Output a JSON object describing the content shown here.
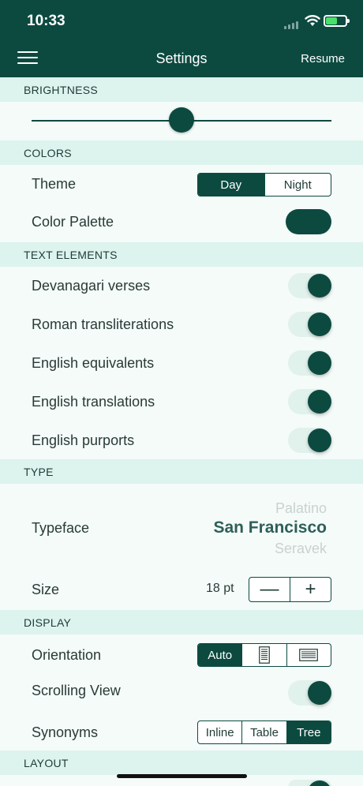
{
  "status_bar": {
    "time": "10:33"
  },
  "nav": {
    "title": "Settings",
    "resume_label": "Resume"
  },
  "brightness": {
    "header": "BRIGHTNESS",
    "level": 0.5
  },
  "colors": {
    "header": "COLORS",
    "theme_label": "Theme",
    "theme_options": [
      "Day",
      "Night"
    ],
    "theme_selected": "Day",
    "palette_label": "Color Palette"
  },
  "text_elements": {
    "header": "TEXT ELEMENTS",
    "items": [
      {
        "label": "Devanagari verses",
        "on": true
      },
      {
        "label": "Roman transliterations",
        "on": true
      },
      {
        "label": "English equivalents",
        "on": true
      },
      {
        "label": "English translations",
        "on": true
      },
      {
        "label": "English purports",
        "on": true
      }
    ]
  },
  "type": {
    "header": "TYPE",
    "typeface_label": "Typeface",
    "typeface_options": [
      "Palatino",
      "San Francisco",
      "Seravek"
    ],
    "typeface_selected": "San Francisco",
    "size_label": "Size",
    "size_value": "18 pt",
    "decrease_symbol": "—",
    "increase_symbol": "+"
  },
  "display": {
    "header": "DISPLAY",
    "orientation_label": "Orientation",
    "orientation_options": [
      "Auto",
      "portrait-page-icon",
      "landscape-page-icon"
    ],
    "orientation_selected": "Auto",
    "scrolling_label": "Scrolling View",
    "scrolling_on": true,
    "synonyms_label": "Synonyms",
    "synonyms_options": [
      "Inline",
      "Table",
      "Tree"
    ],
    "synonyms_selected": "Tree"
  },
  "layout": {
    "header": "LAYOUT"
  },
  "accent_color": "#0c4a40",
  "section_bg": "#dcf3ee"
}
